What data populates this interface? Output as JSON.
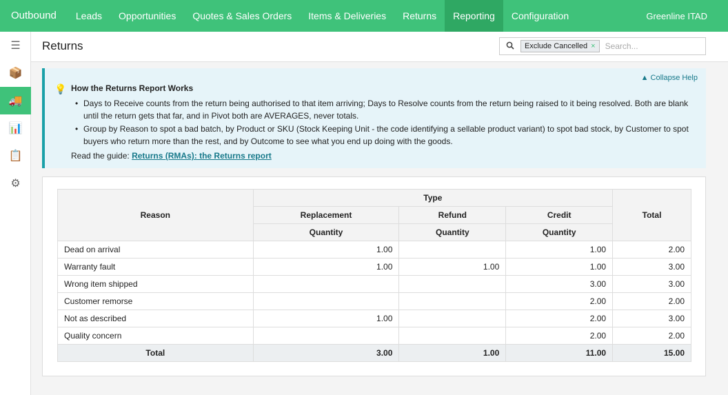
{
  "app": {
    "brand": "Outbound",
    "nav": [
      "Leads",
      "Opportunities",
      "Quotes & Sales Orders",
      "Items & Deliveries",
      "Returns",
      "Reporting",
      "Configuration"
    ],
    "active_nav": "Reporting",
    "company": "Greenline ITAD"
  },
  "sidebar": {
    "items": [
      {
        "icon": "menu-icon",
        "glyph": "☰"
      },
      {
        "icon": "box-icon",
        "glyph": "📦"
      },
      {
        "icon": "truck-icon",
        "glyph": "🚚",
        "active": true
      },
      {
        "icon": "chart-icon",
        "glyph": "📊"
      },
      {
        "icon": "clipboard-icon",
        "glyph": "📋"
      },
      {
        "icon": "gear-icon",
        "glyph": "⚙"
      }
    ]
  },
  "control": {
    "title": "Returns",
    "facet": "Exclude Cancelled",
    "facet_remove": "×",
    "search_placeholder": "Search..."
  },
  "help": {
    "collapse": "▲ Collapse Help",
    "title": "How the Returns Report Works",
    "bullets": [
      "Days to Receive counts from the return being authorised to that item arriving; Days to Resolve counts from the return being raised to it being resolved. Both are blank until the return gets that far, and in Pivot both are AVERAGES, never totals.",
      "Group by Reason to spot a bad batch, by Product or SKU (Stock Keeping Unit - the code identifying a sellable product variant) to spot bad stock, by Customer to spot buyers who return more than the rest, and by Outcome to see what you end up doing with the goods."
    ],
    "guide_prefix": "Read the guide: ",
    "guide_link": "Returns (RMAs): the Returns report"
  },
  "pivot": {
    "row_header": "Reason",
    "group_header": "Type",
    "types": [
      "Replacement",
      "Refund",
      "Credit"
    ],
    "measure": "Quantity",
    "total_header": "Total",
    "rows": [
      {
        "reason": "Dead on arrival",
        "values": [
          "1.00",
          "",
          "1.00"
        ],
        "total": "2.00"
      },
      {
        "reason": "Warranty fault",
        "values": [
          "1.00",
          "1.00",
          "1.00"
        ],
        "total": "3.00"
      },
      {
        "reason": "Wrong item shipped",
        "values": [
          "",
          "",
          "3.00"
        ],
        "total": "3.00"
      },
      {
        "reason": "Customer remorse",
        "values": [
          "",
          "",
          "2.00"
        ],
        "total": "2.00"
      },
      {
        "reason": "Not as described",
        "values": [
          "1.00",
          "",
          "2.00"
        ],
        "total": "3.00"
      },
      {
        "reason": "Quality concern",
        "values": [
          "",
          "",
          "2.00"
        ],
        "total": "2.00"
      }
    ],
    "footer": {
      "label": "Total",
      "values": [
        "3.00",
        "1.00",
        "11.00"
      ],
      "total": "15.00"
    }
  },
  "colors": {
    "brand_green": "#3fc27a",
    "active_nav": "#2fa863",
    "help_bg": "#e6f4f9",
    "help_accent": "#19a0a8",
    "link": "#17798a"
  }
}
